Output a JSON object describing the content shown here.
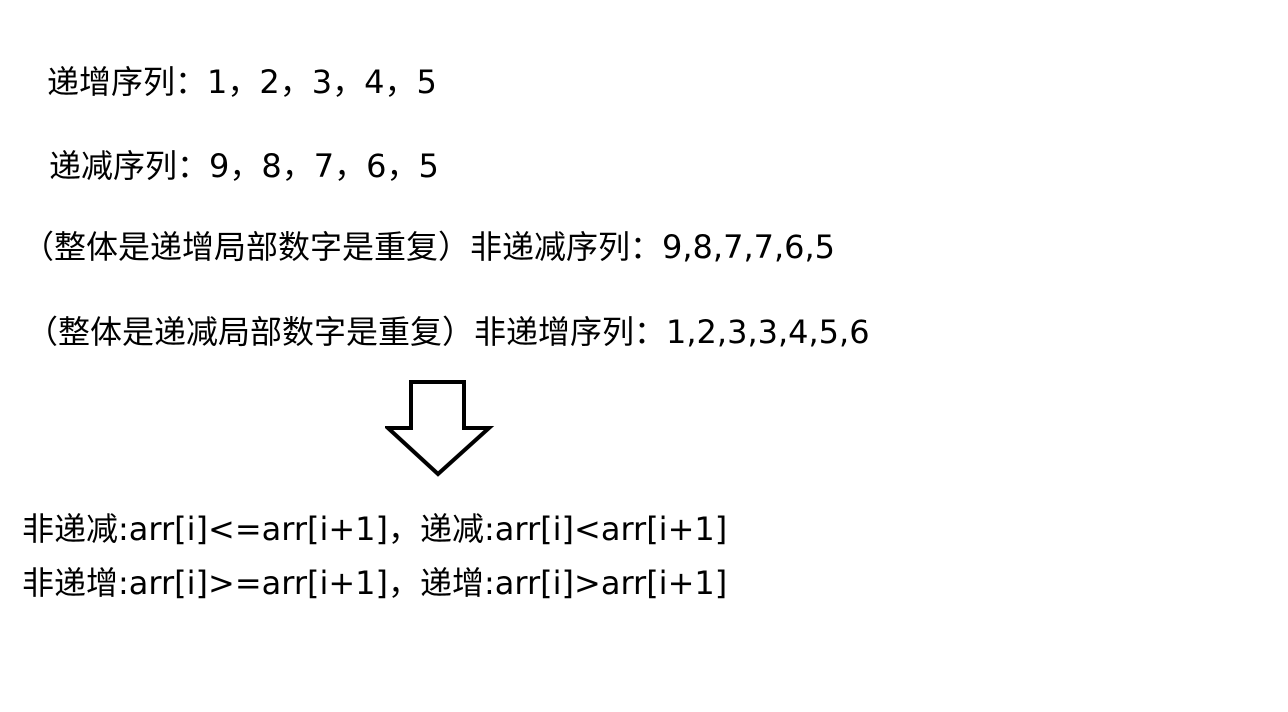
{
  "lines": {
    "increasing": "递增序列：1，2，3，4，5",
    "decreasing": "递减序列：9，8，7，6，5",
    "non_increasing_note": "（整体是递增局部数字是重复）",
    "non_increasing": "非递减序列：9,8,7,7,6,5",
    "non_decreasing_note": "（整体是递减局部数字是重复）",
    "non_decreasing": "非递增序列：1,2,3,3,4,5,6",
    "rule1": "非递减:arr[i]<=arr[i+1]，递减:arr[i]<arr[i+1]",
    "rule2": "非递增:arr[i]>=arr[i+1]，递增:arr[i]>arr[i+1]"
  },
  "arrow": {
    "icon": "down-arrow-icon",
    "color": "#000000"
  }
}
